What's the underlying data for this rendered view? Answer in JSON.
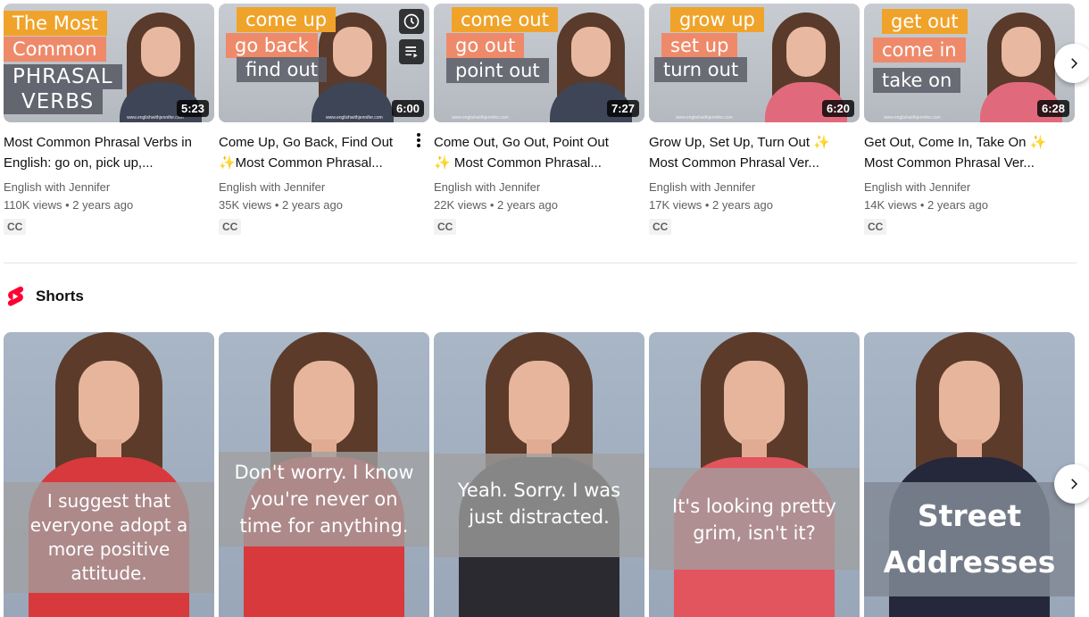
{
  "videos": [
    {
      "title": "Most Common Phrasal Verbs in English: go on, pick up,...",
      "channel": "English with Jennifer",
      "meta": "110K views • 2 years ago",
      "badge": "CC",
      "duration": "5:23",
      "thumb_lines": [
        "The Most",
        "Common",
        "PHRASAL",
        "VERBS"
      ],
      "watermark": "www.englishwithjennifer.com"
    },
    {
      "title": "Come Up, Go Back, Find Out ✨Most Common Phrasal...",
      "channel": "English with Jennifer",
      "meta": "35K views • 2 years ago",
      "badge": "CC",
      "duration": "6:00",
      "thumb_lines": [
        "come up",
        "go back",
        "find out"
      ],
      "watermark": "www.englishwithjennifer.com"
    },
    {
      "title": "Come Out, Go Out, Point Out ✨ Most Common Phrasal...",
      "channel": "English with Jennifer",
      "meta": "22K views • 2 years ago",
      "badge": "CC",
      "duration": "7:27",
      "thumb_lines": [
        "come out",
        "go out",
        "point out"
      ],
      "watermark": "www.englishwithjennifer.com"
    },
    {
      "title": "Grow Up, Set Up, Turn Out ✨ Most Common Phrasal Ver...",
      "channel": "English with Jennifer",
      "meta": "17K views • 2 years ago",
      "badge": "CC",
      "duration": "6:20",
      "thumb_lines": [
        "grow up",
        "set up",
        "turn out"
      ],
      "watermark": "www.englishwithjennifer.com"
    },
    {
      "title": "Get Out, Come In, Take On ✨ Most Common Phrasal Ver...",
      "channel": "English with Jennifer",
      "meta": "14K views • 2 years ago",
      "badge": "CC",
      "duration": "6:28",
      "thumb_lines": [
        "get out",
        "come in",
        "take on"
      ],
      "watermark": "www.englishwithjennifer.com"
    }
  ],
  "shorts": {
    "label": "Shorts",
    "items": [
      {
        "caption": "I suggest that everyone adopt a more positive attitude."
      },
      {
        "caption": "Don't worry. I know you're never on time for anything."
      },
      {
        "caption": "Yeah. Sorry. I was just distracted."
      },
      {
        "caption": "It's looking pretty grim, isn't it?"
      },
      {
        "caption": "Street Addresses"
      }
    ]
  },
  "icons": {
    "shorts_logo": "youtube-shorts-icon",
    "next": "chevron-right-icon",
    "watch_later": "clock-icon",
    "add_to_queue": "queue-icon",
    "more": "more-vert-icon"
  },
  "colors": {
    "shorts_red": "#ff0033",
    "orange_box": "#f0a32a",
    "salmon_box": "#ee8a6a"
  }
}
